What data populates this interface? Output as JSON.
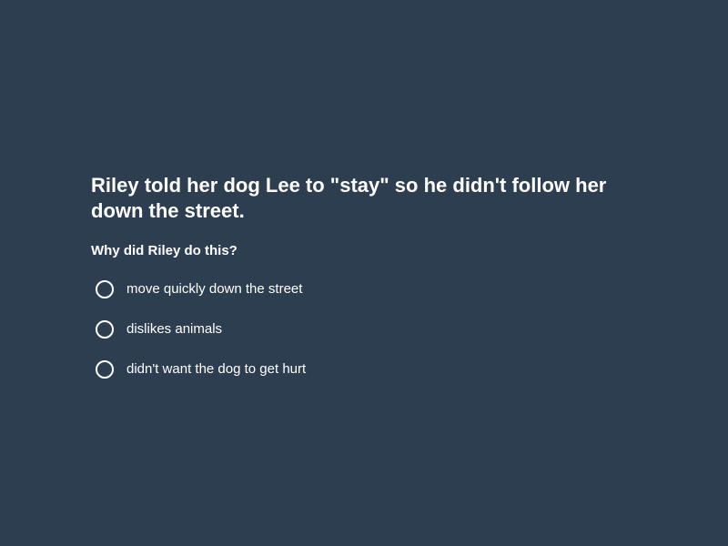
{
  "quiz": {
    "prompt": "Riley told her dog Lee to \"stay\" so he didn't follow her down the street.",
    "question": "Why did Riley do this?",
    "options": [
      {
        "label": "move quickly down the street",
        "selected": false
      },
      {
        "label": "dislikes animals",
        "selected": false
      },
      {
        "label": "didn't want the dog to get hurt",
        "selected": false
      }
    ]
  },
  "colors": {
    "background": "#2e3e51",
    "text": "#ffffff"
  }
}
